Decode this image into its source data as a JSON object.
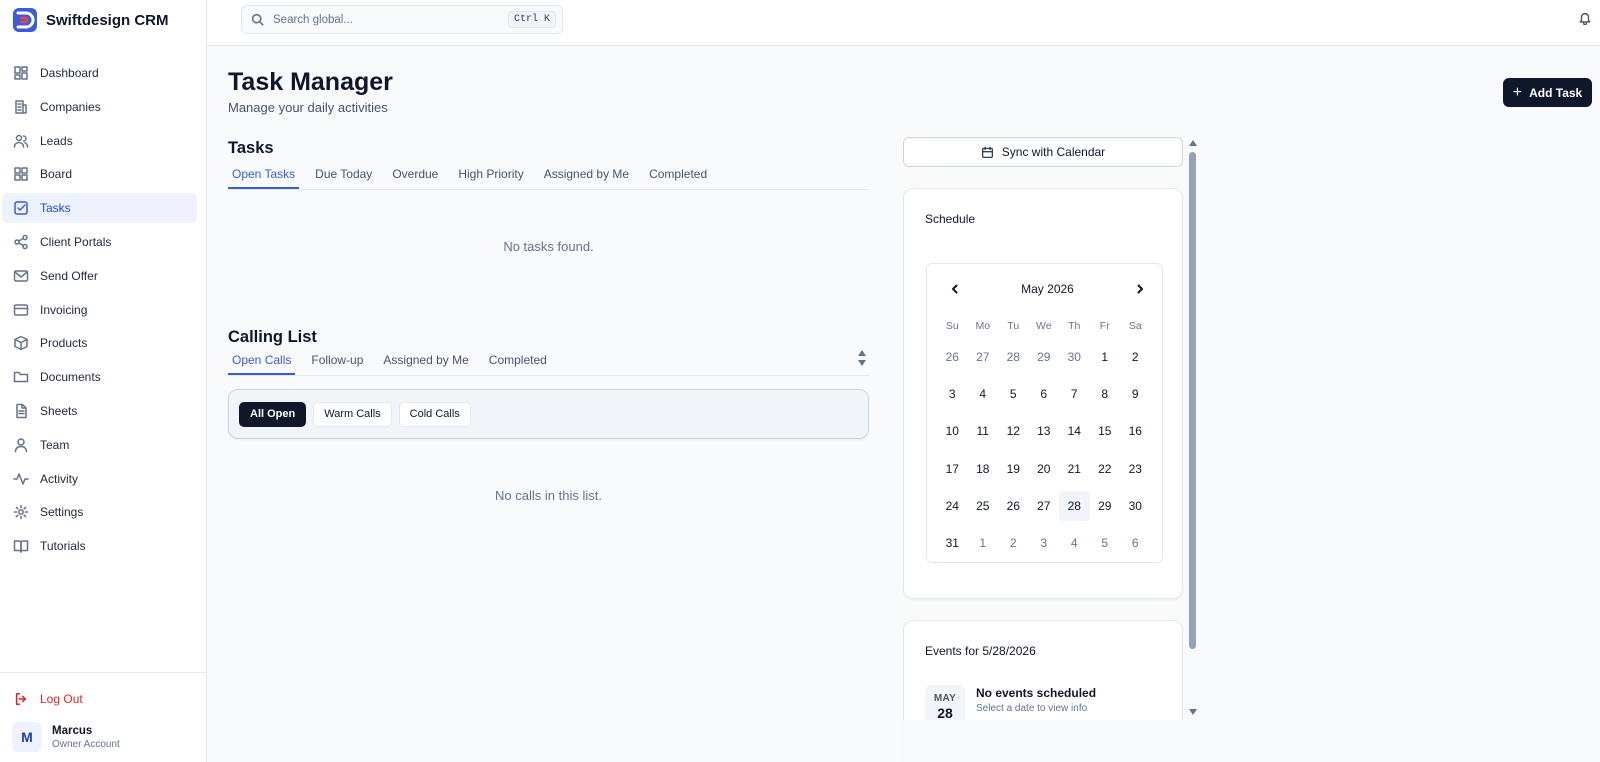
{
  "app": {
    "name": "Swiftdesign CRM",
    "accent": "#3b5bdb",
    "dark": "#0f172a"
  },
  "sidebar": {
    "items": [
      {
        "label": "Dashboard",
        "icon": "dashboard-icon"
      },
      {
        "label": "Companies",
        "icon": "building-icon"
      },
      {
        "label": "Leads",
        "icon": "users-icon"
      },
      {
        "label": "Board",
        "icon": "board-icon"
      },
      {
        "label": "Tasks",
        "icon": "checkbox-icon",
        "active": true
      },
      {
        "label": "Client Portals",
        "icon": "share-icon"
      },
      {
        "label": "Send Offer",
        "icon": "mail-icon"
      },
      {
        "label": "Invoicing",
        "icon": "card-icon"
      },
      {
        "label": "Products",
        "icon": "box-icon"
      },
      {
        "label": "Documents",
        "icon": "folder-icon"
      },
      {
        "label": "Sheets",
        "icon": "file-icon"
      },
      {
        "label": "Team",
        "icon": "user-icon"
      },
      {
        "label": "Activity",
        "icon": "activity-icon"
      },
      {
        "label": "Settings",
        "icon": "gear-icon"
      },
      {
        "label": "Tutorials",
        "icon": "book-icon"
      }
    ],
    "logout": "Log Out",
    "user": {
      "initial": "M",
      "name": "Marcus",
      "role": "Owner Account"
    }
  },
  "topbar": {
    "search_placeholder": "Search global...",
    "shortcut": "Ctrl K"
  },
  "header": {
    "title": "Task Manager",
    "subtitle": "Manage your daily activities",
    "add_task": "Add Task"
  },
  "tasks": {
    "title": "Tasks",
    "tabs": [
      "Open Tasks",
      "Due Today",
      "Overdue",
      "High Priority",
      "Assigned by Me",
      "Completed"
    ],
    "empty": "No tasks found."
  },
  "calling": {
    "title": "Calling List",
    "tabs": [
      "Open Calls",
      "Follow-up",
      "Assigned by Me",
      "Completed"
    ],
    "filters": [
      "All Open",
      "Warm Calls",
      "Cold Calls"
    ],
    "empty": "No calls in this list."
  },
  "sync": "Sync with Calendar",
  "schedule": {
    "title": "Schedule",
    "month": "May 2026",
    "dow": [
      "Su",
      "Mo",
      "Tu",
      "We",
      "Th",
      "Fr",
      "Sa"
    ],
    "weeks": [
      [
        "26",
        "27",
        "28",
        "29",
        "30",
        "1",
        "2"
      ],
      [
        "3",
        "4",
        "5",
        "6",
        "7",
        "8",
        "9"
      ],
      [
        "10",
        "11",
        "12",
        "13",
        "14",
        "15",
        "16"
      ],
      [
        "17",
        "18",
        "19",
        "20",
        "21",
        "22",
        "23"
      ],
      [
        "24",
        "25",
        "26",
        "27",
        "28",
        "29",
        "30"
      ],
      [
        "31",
        "1",
        "2",
        "3",
        "4",
        "5",
        "6"
      ]
    ],
    "muted": [
      [
        0,
        0
      ],
      [
        0,
        1
      ],
      [
        0,
        2
      ],
      [
        0,
        3
      ],
      [
        0,
        4
      ],
      [
        5,
        1
      ],
      [
        5,
        2
      ],
      [
        5,
        3
      ],
      [
        5,
        4
      ],
      [
        5,
        5
      ],
      [
        5,
        6
      ]
    ],
    "selected": [
      4,
      4
    ]
  },
  "events": {
    "title": "Events for 5/28/2026",
    "badge_month": "MAY",
    "badge_day": "28",
    "empty_title": "No events scheduled",
    "empty_sub": "Select a date to view info"
  }
}
